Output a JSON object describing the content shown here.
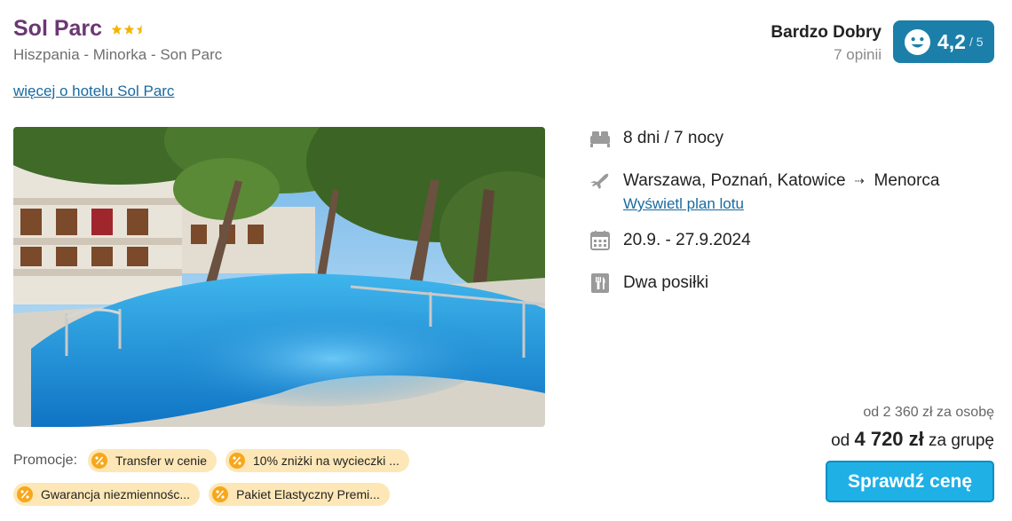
{
  "hotel": {
    "name": "Sol Parc",
    "star_rating": 2.5,
    "location": "Hiszpania - Minorka - Son Parc",
    "more_link": "więcej o hotelu Sol Parc"
  },
  "rating": {
    "label": "Bardzo Dobry",
    "reviews": "7 opinii",
    "value": "4,2",
    "max": "/ 5",
    "badge_color": "#1c7fa9",
    "icon": "smiley-icon"
  },
  "details": {
    "duration": {
      "icon": "bed-icon",
      "text": "8 dni / 7 nocy"
    },
    "flight": {
      "icon": "plane-icon",
      "from": "Warszawa, Poznań, Katowice",
      "arrow": "⇢",
      "to": "Menorca",
      "link": "Wyświetl plan lotu"
    },
    "dates": {
      "icon": "calendar-icon",
      "text": "20.9. - 27.9.2024"
    },
    "board": {
      "icon": "food-icon",
      "text": "Dwa posiłki"
    }
  },
  "promotions": {
    "label": "Promocje:",
    "chip_color": "#fde7b7",
    "items": [
      {
        "text": "Transfer w cenie"
      },
      {
        "text": "10% zniżki na wycieczki ..."
      },
      {
        "text": "Gwarancja niezmiennośc..."
      },
      {
        "text": "Pakiet Elastyczny Premi..."
      }
    ]
  },
  "price": {
    "per_person": "od 2 360 zł za osobę",
    "group_prefix": "od",
    "group_amount": "4 720 zł",
    "group_suffix": "za grupę",
    "button": "Sprawdź cenę",
    "button_color": "#1fb0e6"
  }
}
